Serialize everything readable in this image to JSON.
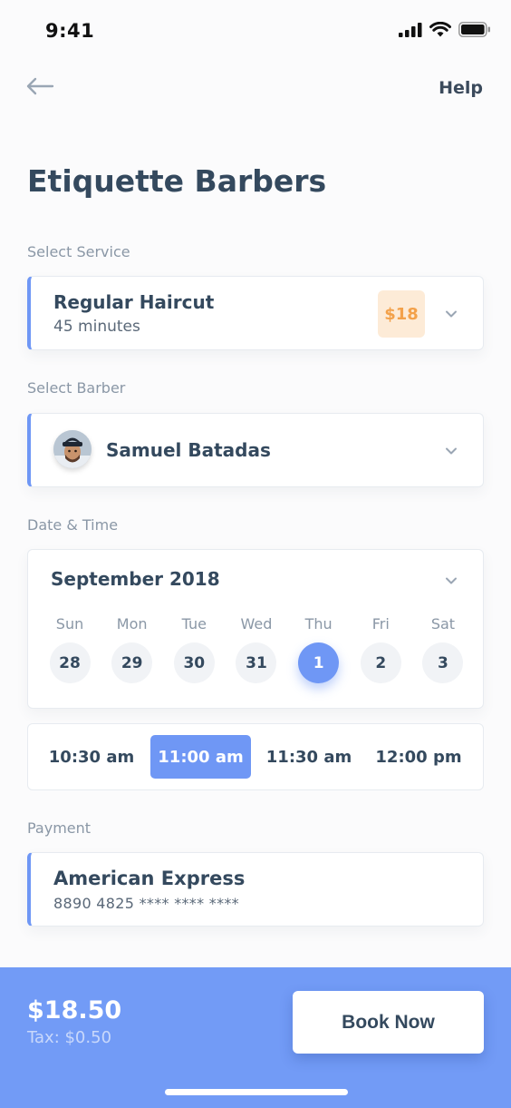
{
  "status_bar": {
    "time": "9:41"
  },
  "nav": {
    "help": "Help"
  },
  "title": "Etiquette Barbers",
  "service": {
    "label": "Select Service",
    "name": "Regular Haircut",
    "duration": "45 minutes",
    "price": "$18"
  },
  "barber": {
    "label": "Select Barber",
    "name": "Samuel Batadas"
  },
  "datetime": {
    "label": "Date & Time",
    "month": "September 2018",
    "days": [
      {
        "name": "Sun",
        "num": "28"
      },
      {
        "name": "Mon",
        "num": "29"
      },
      {
        "name": "Tue",
        "num": "30"
      },
      {
        "name": "Wed",
        "num": "31"
      },
      {
        "name": "Thu",
        "num": "1"
      },
      {
        "name": "Fri",
        "num": "2"
      },
      {
        "name": "Sat",
        "num": "3"
      }
    ],
    "selected_day": "1",
    "times": [
      "10:30 am",
      "11:00 am",
      "11:30 am",
      "12:00 pm"
    ],
    "selected_time": "11:00 am"
  },
  "payment": {
    "label": "Payment",
    "method": "American Express",
    "card_number": "8890 4825 **** **** ****"
  },
  "footer": {
    "total": "$18.50",
    "tax": "Tax: $0.50",
    "book": "Book Now"
  },
  "colors": {
    "accent": "#6f97f5",
    "footer_bg": "#729bf6",
    "price_bg": "#fdebd7",
    "price_text": "#f3a14a",
    "heading": "#34495e"
  }
}
